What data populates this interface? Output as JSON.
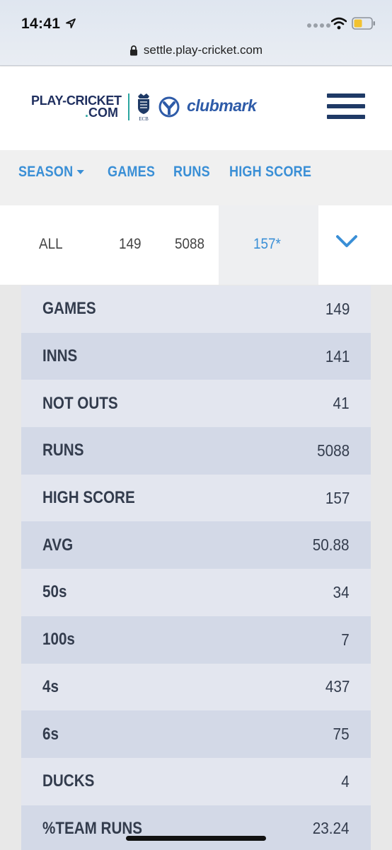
{
  "status_bar": {
    "time": "14:41"
  },
  "browser": {
    "url": "settle.play-cricket.com"
  },
  "header": {
    "logo_line1": "PLAY-CRICKET",
    "logo_line2": "COM",
    "ecb_label": "ECB",
    "partner_label": "clubmark"
  },
  "columns": {
    "season": "SEASON",
    "games": "GAMES",
    "runs": "RUNS",
    "high_score": "HIGH SCORE"
  },
  "summary": {
    "season": "ALL",
    "games": "149",
    "runs": "5088",
    "high_score": "157*"
  },
  "stats": [
    {
      "label": "GAMES",
      "value": "149"
    },
    {
      "label": "INNS",
      "value": "141"
    },
    {
      "label": "NOT OUTS",
      "value": "41"
    },
    {
      "label": "RUNS",
      "value": "5088"
    },
    {
      "label": "HIGH SCORE",
      "value": "157"
    },
    {
      "label": "AVG",
      "value": "50.88"
    },
    {
      "label": "50s",
      "value": "34"
    },
    {
      "label": "100s",
      "value": "7"
    },
    {
      "label": "4s",
      "value": "437"
    },
    {
      "label": "6s",
      "value": "75"
    },
    {
      "label": "DUCKS",
      "value": "4"
    },
    {
      "label": "%TEAM RUNS",
      "value": "23.24"
    }
  ],
  "colors": {
    "accent": "#3a8fd6",
    "navy": "#1f3a66",
    "teal": "#2aa6a0"
  }
}
